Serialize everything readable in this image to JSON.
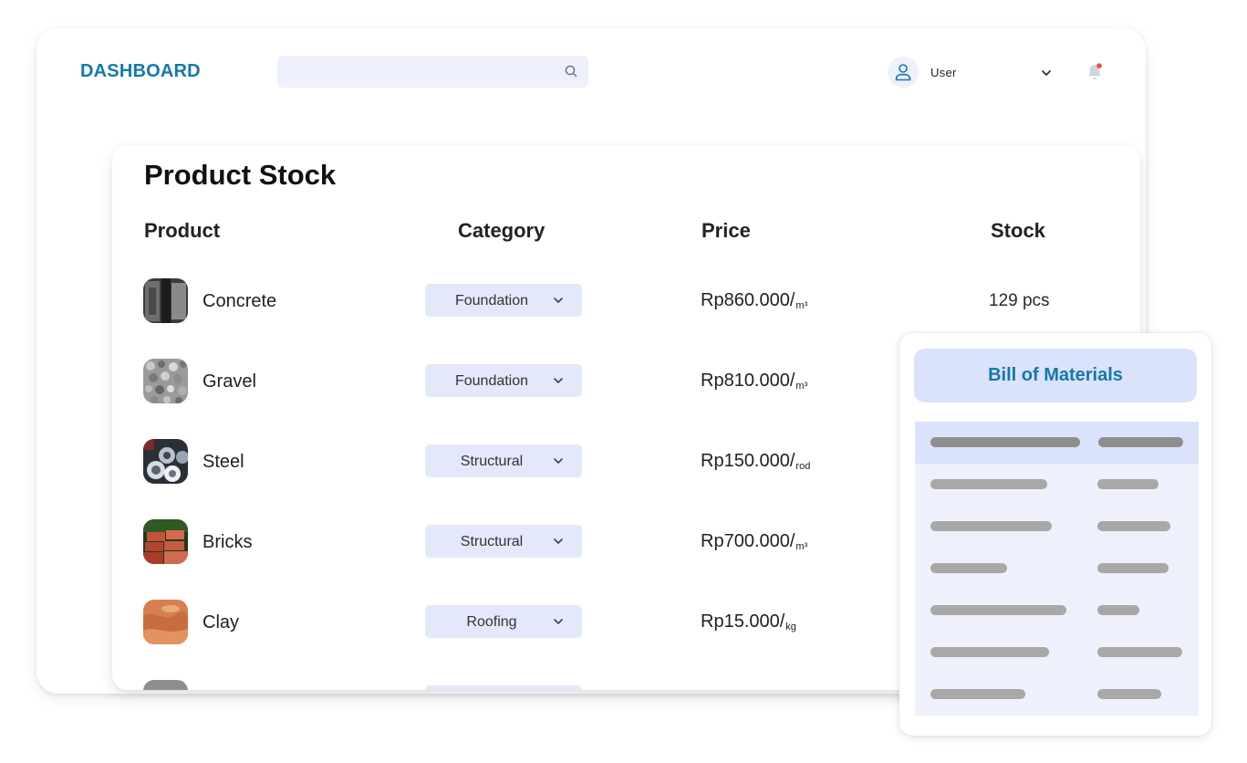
{
  "header": {
    "brand": "DASHBOARD",
    "search_placeholder": "",
    "user_label": "User"
  },
  "product_stock": {
    "title": "Product Stock",
    "columns": {
      "product": "Product",
      "category": "Category",
      "price": "Price",
      "stock": "Stock"
    },
    "rows": [
      {
        "product": "Concrete",
        "category": "Foundation",
        "price": "Rp860.000/",
        "unit": "m³",
        "stock": "129 pcs"
      },
      {
        "product": "Gravel",
        "category": "Foundation",
        "price": "Rp810.000/",
        "unit": "m³",
        "stock": ""
      },
      {
        "product": "Steel",
        "category": "Structural",
        "price": "Rp150.000/",
        "unit": "rod",
        "stock": ""
      },
      {
        "product": "Bricks",
        "category": "Structural",
        "price": "Rp700.000/",
        "unit": "m³",
        "stock": ""
      },
      {
        "product": "Clay",
        "category": "Roofing",
        "price": "Rp15.000/",
        "unit": "kg",
        "stock": ""
      }
    ]
  },
  "bill_of_materials": {
    "title": "Bill of Materials"
  },
  "colors": {
    "accent": "#1478ad",
    "chip_bg": "#e3e8fb",
    "search_bg": "#eef1fb",
    "notification_dot": "#e74c4c"
  },
  "icons": {
    "search": "search-icon",
    "user": "user-icon",
    "dropdown": "chevron-down-icon",
    "notification": "bell-icon"
  }
}
